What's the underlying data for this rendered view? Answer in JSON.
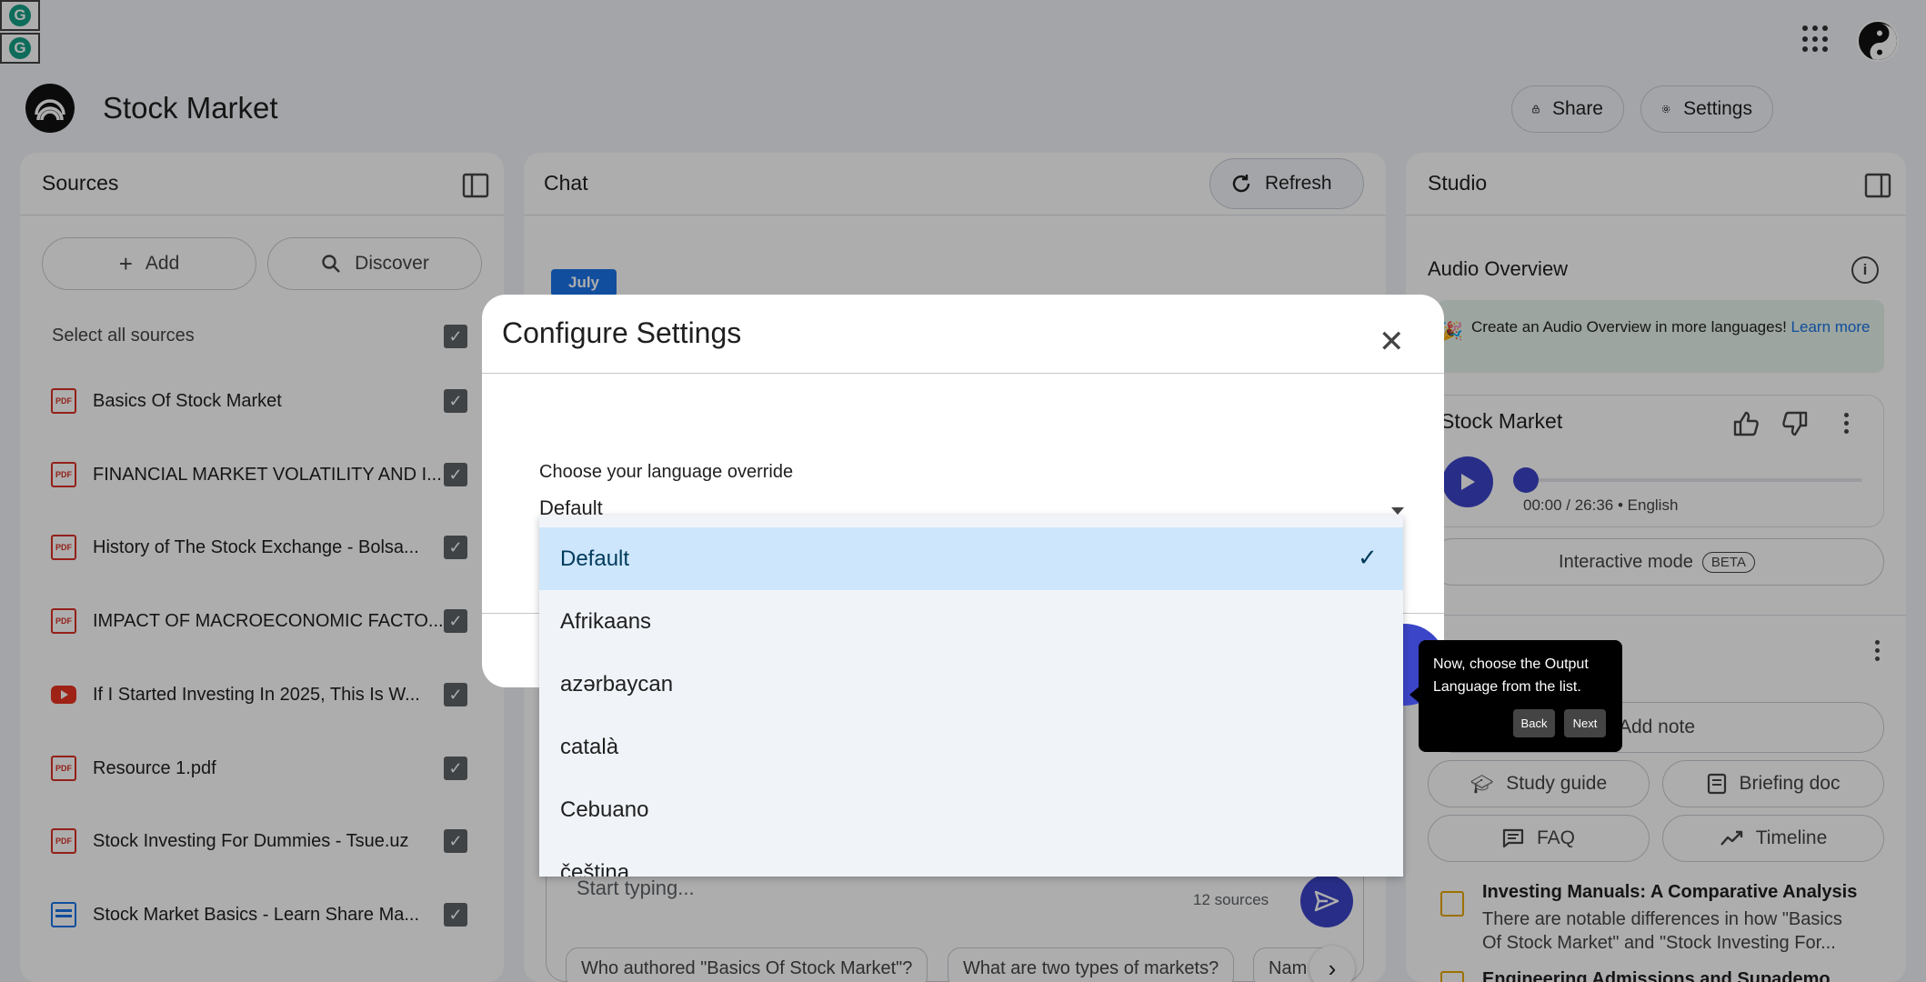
{
  "header": {
    "notebook_title": "Stock Market",
    "share_label": "Share",
    "settings_label": "Settings"
  },
  "sources": {
    "title": "Sources",
    "add_label": "Add",
    "discover_label": "Discover",
    "select_all_label": "Select all sources",
    "items": [
      {
        "label": "Basics Of Stock Market",
        "type": "pdf",
        "checked": true
      },
      {
        "label": "FINANCIAL MARKET VOLATILITY AND I...",
        "type": "pdf",
        "checked": true
      },
      {
        "label": "History of The Stock Exchange - Bolsa...",
        "type": "pdf",
        "checked": true
      },
      {
        "label": "IMPACT OF MACROECONOMIC FACTO...",
        "type": "pdf",
        "checked": true
      },
      {
        "label": "If I Started Investing In 2025, This Is W...",
        "type": "youtube",
        "checked": true
      },
      {
        "label": "Resource 1.pdf",
        "type": "pdf",
        "checked": true
      },
      {
        "label": "Stock Investing For Dummies - Tsue.uz",
        "type": "pdf",
        "checked": true
      },
      {
        "label": "Stock Market Basics - Learn Share Ma...",
        "type": "web",
        "checked": true
      }
    ]
  },
  "chat": {
    "title": "Chat",
    "refresh_label": "Refresh",
    "calendar_label": "July",
    "input_placeholder": "Start typing...",
    "source_count": "12 sources",
    "suggestions": [
      "Who authored \"Basics Of Stock Market\"?",
      "What are two types of markets?",
      "Nam"
    ]
  },
  "studio": {
    "title": "Studio",
    "audio_overview_title": "Audio Overview",
    "banner_text": "Create an Audio Overview in more languages!",
    "banner_link": "Learn more",
    "audio_title": "Stock Market",
    "audio_time": "00:00 / 26:36 • English",
    "progress_fraction": 0.0,
    "interactive_label": "Interactive mode",
    "beta_label": "BETA",
    "add_note_label": "Add note",
    "study_guide_label": "Study guide",
    "briefing_doc_label": "Briefing doc",
    "faq_label": "FAQ",
    "timeline_label": "Timeline",
    "notes": [
      {
        "title": "Investing Manuals: A Comparative Analysis",
        "snippet": "There are notable differences in how \"Basics Of Stock Market\" and \"Stock Investing For..."
      },
      {
        "title": "Engineering Admissions and Supademo",
        "snippet": ""
      }
    ]
  },
  "dialog": {
    "title": "Configure Settings",
    "language_label": "Choose your language override",
    "selected_value": "Default",
    "options": [
      "Default",
      "Afrikaans",
      "azərbaycan",
      "català",
      "Cebuano",
      "čeština"
    ]
  },
  "tooltip": {
    "text": "Now, choose the Output Language from the list.",
    "back_label": "Back",
    "next_label": "Next"
  },
  "colors": {
    "accent": "#3b45c8",
    "selected_option_bg": "#cde6fb",
    "banner_bg": "#e6f4ea"
  }
}
